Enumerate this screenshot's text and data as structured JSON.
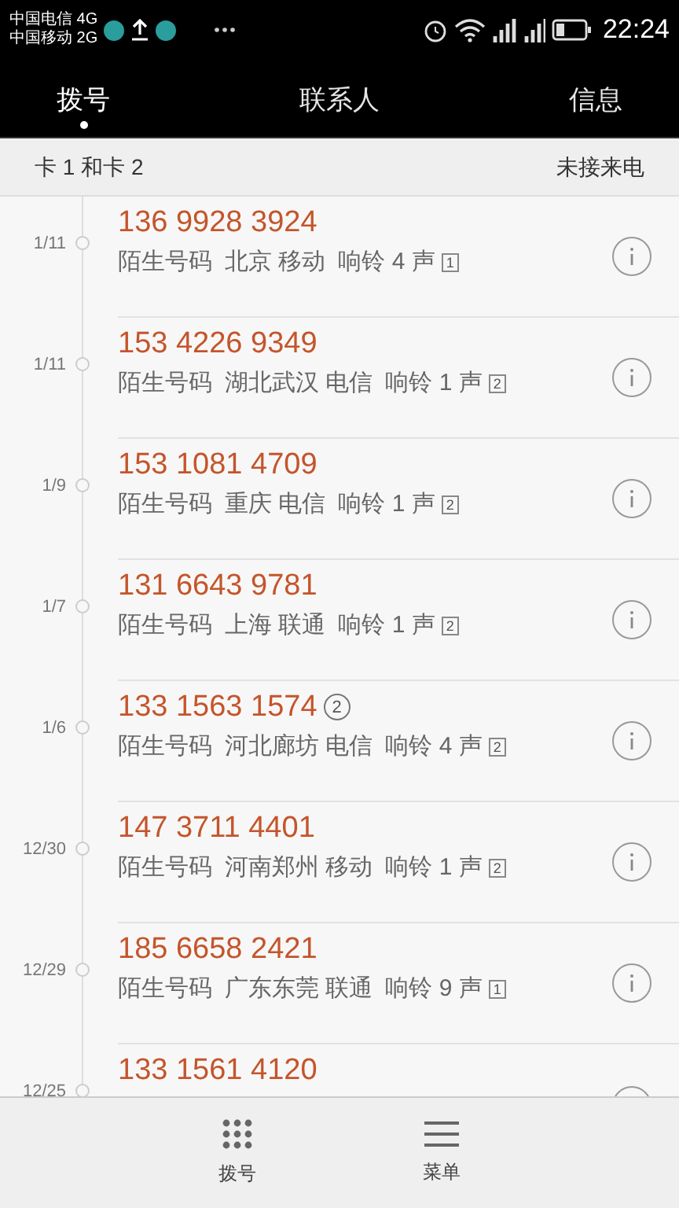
{
  "status_bar": {
    "carriers": [
      "中国电信 4G",
      "中国移动 2G"
    ],
    "time": "22:24"
  },
  "tabs": [
    {
      "label": "拨号",
      "selected": true
    },
    {
      "label": "联系人",
      "selected": false
    },
    {
      "label": "信息",
      "selected": false
    }
  ],
  "filter": {
    "sim": "卡 1 和卡 2",
    "type": "未接来电"
  },
  "calls": [
    {
      "date": "1/11",
      "number": "136 9928 3924",
      "label": "陌生号码",
      "location": "北京 移动",
      "rings": "响铃 4 声",
      "sim": "1"
    },
    {
      "date": "1/11",
      "number": "153 4226 9349",
      "label": "陌生号码",
      "location": "湖北武汉 电信",
      "rings": "响铃 1 声",
      "sim": "2"
    },
    {
      "date": "1/9",
      "number": "153 1081 4709",
      "label": "陌生号码",
      "location": "重庆 电信",
      "rings": "响铃 1 声",
      "sim": "2"
    },
    {
      "date": "1/7",
      "number": "131 6643 9781",
      "label": "陌生号码",
      "location": "上海 联通",
      "rings": "响铃 1 声",
      "sim": "2"
    },
    {
      "date": "1/6",
      "number": "133 1563 1574",
      "number_sim": "2",
      "label": "陌生号码",
      "location": "河北廊坊 电信",
      "rings": "响铃 4 声",
      "sim": "2"
    },
    {
      "date": "12/30",
      "number": "147 3711 4401",
      "label": "陌生号码",
      "location": "河南郑州 移动",
      "rings": "响铃 1 声",
      "sim": "2"
    },
    {
      "date": "12/29",
      "number": "185 6658 2421",
      "label": "陌生号码",
      "location": "广东东莞 联通",
      "rings": "响铃 9 声",
      "sim": "1"
    },
    {
      "date": "12/25",
      "number": "133 1561 4120"
    }
  ],
  "bottom_bar": [
    {
      "kind": "dialpad",
      "label": "拨号"
    },
    {
      "kind": "menu",
      "label": "菜单"
    }
  ]
}
